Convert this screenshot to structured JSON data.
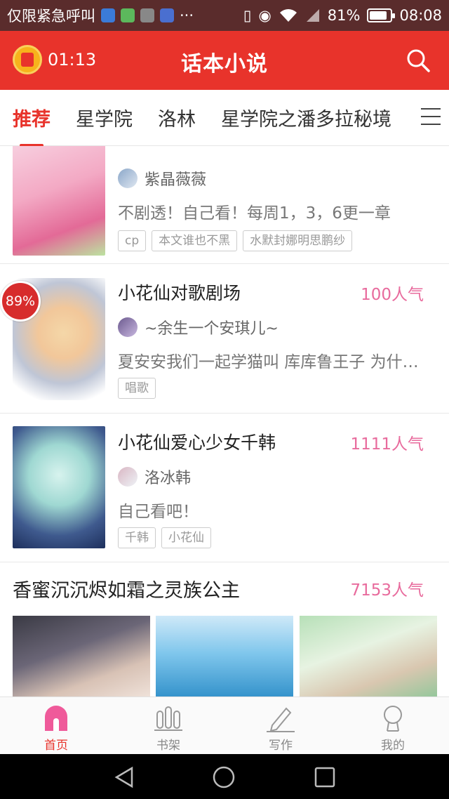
{
  "status_bar": {
    "left_text": "仅限紧急呼叫",
    "battery": "81%",
    "time": "08:08"
  },
  "header": {
    "timer": "01:13",
    "title": "话本小说"
  },
  "tabs": [
    "推荐",
    "星学院",
    "洛林",
    "星学院之潘多拉秘境"
  ],
  "items": [
    {
      "title": "",
      "popularity": "",
      "author": "紫晶薇薇",
      "desc": "不剧透！自己看！每周1，3，6更一章",
      "tags": [
        "cp",
        "本文谁也不黑",
        "水默封娜明思鹏纱"
      ]
    },
    {
      "badge": "89%",
      "title": "小花仙对歌剧场",
      "popularity": "100人气",
      "author": "~余生一个安琪儿~",
      "desc": "夏安安我们一起学猫叫 库库鲁王子 为什…",
      "tags": [
        "唱歌"
      ]
    },
    {
      "title": "小花仙爱心少女千韩",
      "popularity": "1111人气",
      "author": "洛冰韩",
      "desc": "自己看吧！",
      "tags": [
        "千韩",
        "小花仙"
      ]
    }
  ],
  "album": {
    "title": "香蜜沉沉烬如霜之灵族公主",
    "popularity": "7153人气"
  },
  "bottom_nav": [
    "首页",
    "书架",
    "写作",
    "我的"
  ],
  "colors": {
    "accent": "#e8332b",
    "popularity": "#e86b9d"
  }
}
